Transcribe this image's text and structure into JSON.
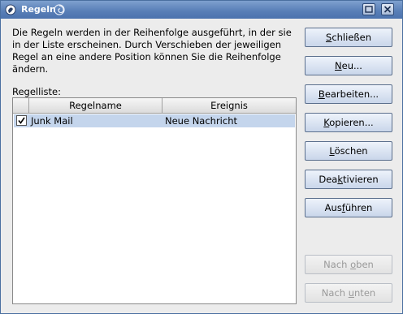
{
  "window": {
    "title": "Regeln",
    "accent": "#5a80b8",
    "controls": [
      "maximize-icon",
      "close-icon"
    ]
  },
  "intro_text": "Die Regeln werden in der Reihenfolge ausgeführt, in der sie in der Liste erscheinen. Durch Verschieben der jeweiligen Regel an eine andere Position können Sie die Reihenfolge ändern.",
  "rule_list": {
    "label": "Regelliste:",
    "columns": [
      "Regelname",
      "Ereignis"
    ],
    "rows": [
      {
        "enabled": true,
        "name": "Junk Mail",
        "event": "Neue Nachricht",
        "selected": true
      }
    ]
  },
  "buttons": {
    "close": {
      "pre": "",
      "key": "S",
      "post": "chließen",
      "enabled": true
    },
    "new": {
      "pre": "",
      "key": "N",
      "post": "eu...",
      "enabled": true
    },
    "edit": {
      "pre": "",
      "key": "B",
      "post": "earbeiten...",
      "enabled": true
    },
    "copy": {
      "pre": "",
      "key": "K",
      "post": "opieren...",
      "enabled": true
    },
    "delete": {
      "pre": "",
      "key": "L",
      "post": "öschen",
      "enabled": true
    },
    "disable": {
      "pre": "Dea",
      "key": "k",
      "post": "tivieren",
      "enabled": true
    },
    "run": {
      "pre": "Aus",
      "key": "f",
      "post": "ühren",
      "enabled": true
    },
    "move_up": {
      "pre": "Nach ",
      "key": "o",
      "post": "ben",
      "enabled": false
    },
    "move_down": {
      "pre": "Nach ",
      "key": "u",
      "post": "nten",
      "enabled": false
    }
  }
}
